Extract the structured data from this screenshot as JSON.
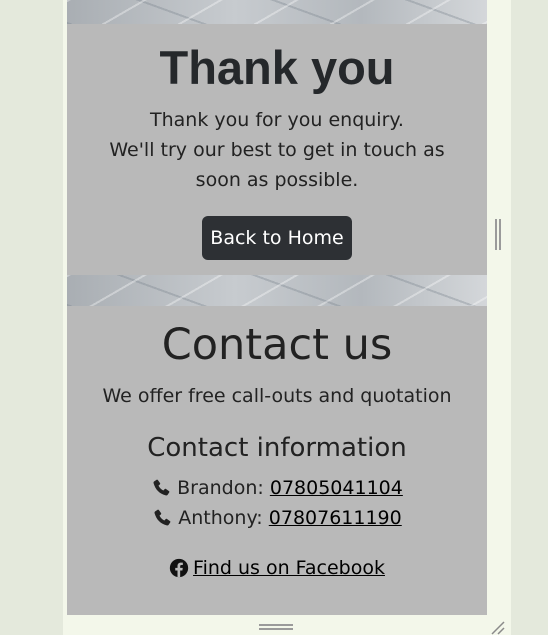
{
  "thank_you": {
    "title": "Thank you",
    "message_line1": "Thank you for you enquiry.",
    "message_line2": "We'll try our best to get in touch as soon as possible.",
    "home_button_label": "Back to Home"
  },
  "contact": {
    "title": "Contact us",
    "subtitle": "We offer free call-outs and quotation",
    "info_title": "Contact information",
    "people": [
      {
        "name": "Brandon:",
        "phone": "07805041104"
      },
      {
        "name": "Anthony:",
        "phone": "07807611190"
      }
    ],
    "facebook_label": " Find us on Facebook"
  },
  "icons": {
    "phone": "phone-icon",
    "facebook": "facebook-icon"
  },
  "colors": {
    "section_bg": "#b9b9b9",
    "button_bg": "#2d3034",
    "page_bg": "#e4e9dc"
  }
}
